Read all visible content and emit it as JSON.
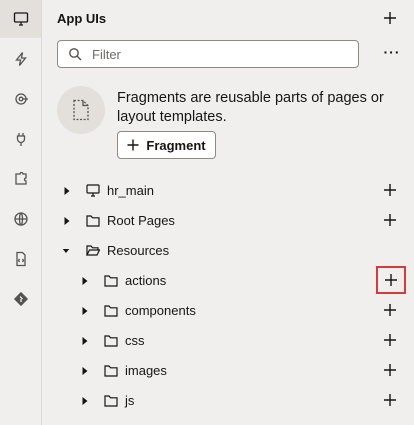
{
  "panel": {
    "title": "App UIs",
    "filter_placeholder": "Filter",
    "more_label": "···",
    "fragments_text": "Fragments are reusable parts of pages or layout templates.",
    "fragment_button_label": "Fragment"
  },
  "rail": {
    "items": [
      "desktop-icon",
      "lightning-icon",
      "service-icon",
      "plug-icon",
      "puzzle-icon",
      "globe-icon",
      "document-icon",
      "git-icon"
    ],
    "active": "desktop-icon"
  },
  "tree": {
    "items": [
      {
        "label": "hr_main",
        "icon": "desktop-icon",
        "level": 0,
        "expanded": false
      },
      {
        "label": "Root Pages",
        "icon": "folder-icon",
        "level": 0,
        "expanded": false
      },
      {
        "label": "Resources",
        "icon": "folder-open-icon",
        "level": 0,
        "expanded": true
      },
      {
        "label": "actions",
        "icon": "folder-icon",
        "level": 1,
        "expanded": false,
        "highlighted": true
      },
      {
        "label": "components",
        "icon": "folder-icon",
        "level": 1,
        "expanded": false
      },
      {
        "label": "css",
        "icon": "folder-icon",
        "level": 1,
        "expanded": false
      },
      {
        "label": "images",
        "icon": "folder-icon",
        "level": 1,
        "expanded": false
      },
      {
        "label": "js",
        "icon": "folder-icon",
        "level": 1,
        "expanded": false
      }
    ]
  },
  "colors": {
    "background": "#f1efed",
    "highlight": "#d63b3b",
    "text": "#161513"
  }
}
